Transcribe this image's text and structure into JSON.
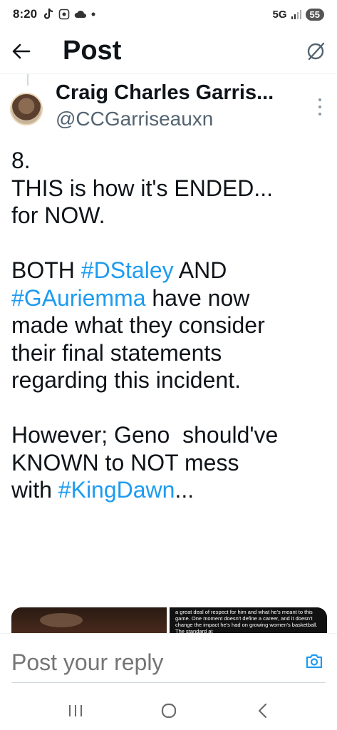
{
  "status_bar": {
    "time": "8:20",
    "network": "5G",
    "battery": "55"
  },
  "header": {
    "title": "Post"
  },
  "author": {
    "name": "Craig Charles Garris...",
    "handle": "@CCGarriseauxn"
  },
  "post": {
    "lines": [
      {
        "text": "8."
      },
      {
        "text": "THIS is how it's ENDED..."
      },
      {
        "text": "for NOW."
      },
      {
        "text": ""
      },
      {
        "segments": [
          {
            "text": "BOTH ",
            "hashtag": false
          },
          {
            "text": "#DStaley",
            "hashtag": true
          },
          {
            "text": " AND",
            "hashtag": false
          }
        ]
      },
      {
        "segments": [
          {
            "text": "#GAuriemma",
            "hashtag": true
          },
          {
            "text": " have now",
            "hashtag": false
          }
        ]
      },
      {
        "text": "made what they consider"
      },
      {
        "text": "their final statements"
      },
      {
        "text": "regarding this incident."
      },
      {
        "text": ""
      },
      {
        "text": "However; Geno  should've"
      },
      {
        "text": "KNOWN to NOT mess"
      },
      {
        "segments": [
          {
            "text": "with ",
            "hashtag": false
          },
          {
            "text": "#KingDawn",
            "hashtag": true
          },
          {
            "text": "...",
            "hashtag": false
          }
        ]
      }
    ],
    "media_caption": "a great deal of respect for him and what he's meant to this game. One moment doesn't define a career, and it doesn't change the impact he's had on growing women's basketball. The standard at"
  },
  "reply": {
    "placeholder": "Post your reply"
  },
  "colors": {
    "hashtag": "#1d9bf0",
    "text": "#0f1419",
    "secondary": "#536471"
  }
}
